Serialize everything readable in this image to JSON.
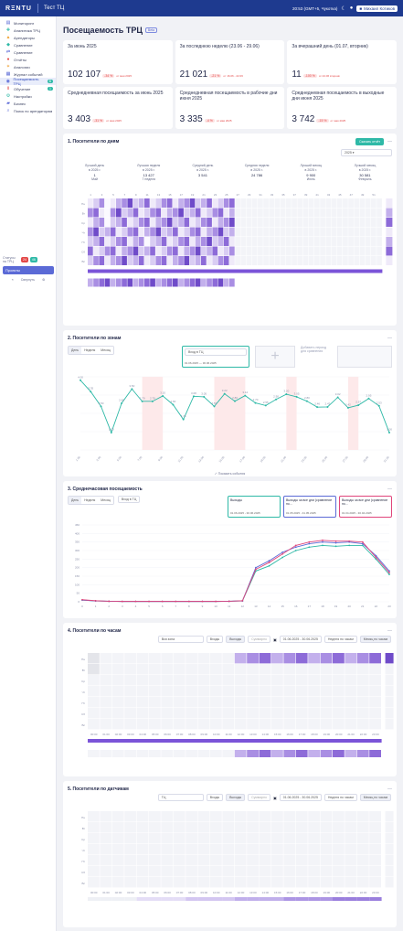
{
  "topbar": {
    "logo": "RΞNTU",
    "project": "Тест ТЦ",
    "datetime": "20:53 (GMT+5, Чукотка)",
    "user": "Михаил Котиков"
  },
  "sidebar": {
    "items": [
      {
        "label": "Мониторинг",
        "icon": "monitor-icon"
      },
      {
        "label": "Аналитика ТРЦ",
        "icon": "analytics-icon"
      },
      {
        "label": "Арендаторы",
        "icon": "tenants-icon"
      },
      {
        "label": "Сравнение",
        "icon": "compare-icon"
      },
      {
        "label": "Сравнение",
        "icon": "compare2-icon"
      },
      {
        "label": "Отчёты",
        "icon": "report-icon"
      },
      {
        "label": "Аналогии",
        "icon": "analogy-icon"
      },
      {
        "label": "Журнал событий",
        "icon": "log-icon"
      },
      {
        "label": "Посещаемость ТРЦ",
        "icon": "visits-icon",
        "active": true,
        "badge": "В"
      },
      {
        "label": "Обучение",
        "icon": "learn-icon",
        "badge": "1"
      },
      {
        "label": "Настройки",
        "icon": "gear-icon"
      },
      {
        "label": "Бизнес",
        "icon": "business-icon"
      },
      {
        "label": "Поиск по арендаторам",
        "icon": "search-icon"
      }
    ],
    "status_label": "Статусы на ТРЦ",
    "status_red": "24",
    "status_green": "46",
    "project_btn": "Проекты",
    "collapse": "Свернуть"
  },
  "page": {
    "title": "Посещаемость ТРЦ",
    "tag": "Beta"
  },
  "cards_row1": [
    {
      "label": "За июнь 2025",
      "value": "102 107",
      "delta": "-34 %",
      "cmp": "от мая 2025"
    },
    {
      "label": "За последнюю неделю (23.06 - 29.06)",
      "value": "21 021",
      "delta": "-21 %",
      "cmp": "от 16.06 - 22.06"
    },
    {
      "label": "За вчерашний день (01.07, вторник)",
      "value": "11",
      "delta": "-100 %",
      "cmp": "от 24.06 вторник"
    }
  ],
  "cards_row2": [
    {
      "label": "Среднедневная посещаемость за июнь 2025",
      "value": "3 403",
      "delta": "-31 %",
      "cmp": "от мая 2025"
    },
    {
      "label": "Среднедневная посещаемость в рабочие дни июня 2025",
      "value": "3 335",
      "delta": "-4 %",
      "cmp": "от мая 2025"
    },
    {
      "label": "Среднедневная посещаемость в выходные дни июня 2025",
      "value": "3 742",
      "delta": "-15 %",
      "cmp": "от мая 2025"
    }
  ],
  "sec1": {
    "title": "1. Посетители по дням",
    "export": "Скачать отчёт",
    "year": "2025",
    "stats": [
      {
        "l1": "Лучший день",
        "l2": "в 2025 г.",
        "v": "1",
        "s": "Май"
      },
      {
        "l1": "Лучшая неделя",
        "l2": "в 2025 г.",
        "v": "13 427",
        "s": "7 неделя"
      },
      {
        "l1": "Средний день",
        "l2": "в 2025 г.",
        "v": "3 541",
        "s": ""
      },
      {
        "l1": "Средняя неделя",
        "l2": "в 2025 г.",
        "v": "24 786",
        "s": ""
      },
      {
        "l1": "Лучший месяц",
        "l2": "в 2025 г.",
        "v": "9 900",
        "s": "Июнь"
      },
      {
        "l1": "Лучший месяц",
        "l2": "в 2025 г.",
        "v": "30 581",
        "s": "Февраль"
      }
    ],
    "weekdays": [
      "Пн",
      "Вт",
      "Ср",
      "Чт",
      "Пт",
      "Сб",
      "Вс"
    ]
  },
  "sec2": {
    "title": "2. Посетители по зонам",
    "tabs": [
      "День",
      "Неделя",
      "Месяц"
    ],
    "zone": "Вход в ТЦ",
    "date_from": "01.06.2025",
    "date_to": "30.06.2025",
    "add": "Добавить период для сравнения",
    "legend": "Показать события"
  },
  "sec3": {
    "title": "3. Среднечасовая посещаемость",
    "tabs": [
      "День",
      "Неделя",
      "Месяц"
    ],
    "zone": "Вход в ТЦ",
    "periods": [
      {
        "label": "Выходы",
        "dates": "01.06.2025 - 30.06.2025",
        "color": "#2fb9a7"
      },
      {
        "label": "Выходы за все дни (сравнение по…",
        "dates": "01.05.2025 - 31.05.2025",
        "color": "#5b6ad6"
      },
      {
        "label": "Выходы за все дни (сравнение по…",
        "dates": "01.04.2025 - 30.04.2025",
        "color": "#e0457b"
      }
    ],
    "yticks": [
      "450",
      "400",
      "350",
      "300",
      "250",
      "200",
      "150",
      "100",
      "50",
      "0"
    ]
  },
  "sec4": {
    "title": "4. Посетители по часам",
    "zone": "Вся зона",
    "entry": "Входы",
    "exit": "Выходы",
    "sum": "Суммарно",
    "range": "01.06.2025 - 30.06.2025",
    "hourly": "Неделя по часам",
    "monthly": "Месяц по часам"
  },
  "sec5": {
    "title": "5. Посетители по датчикам",
    "zone": "ТЦ",
    "entry": "Входы",
    "exit": "Выходы",
    "sum": "Суммарно",
    "range": "01.06.2025 - 30.06.2025",
    "hourly": "Неделя по часам",
    "monthly": "Месяц по часам"
  },
  "chart_data": [
    {
      "type": "line",
      "title": "2. Посетители по зонам",
      "series": [
        {
          "name": "Вход в ТЦ",
          "values": [
            4000,
            3350,
            2500,
            1000,
            2680,
            3500,
            2790,
            2790,
            3100,
            2600,
            1750,
            3080,
            3050,
            2500,
            3220,
            2800,
            3120,
            2700,
            2550,
            2900,
            3200,
            3050,
            2800,
            2460,
            2470,
            3020,
            2420,
            2570,
            2950,
            2530,
            1000
          ]
        }
      ]
    },
    {
      "type": "line",
      "title": "3. Среднечасовая посещаемость",
      "ylim": [
        0,
        450
      ],
      "x": [
        "0",
        "1",
        "2",
        "3",
        "4",
        "5",
        "6",
        "7",
        "8",
        "9",
        "10",
        "11",
        "12",
        "13",
        "14",
        "15",
        "16",
        "17",
        "18",
        "19",
        "20",
        "21",
        "22",
        "23"
      ],
      "series": [
        {
          "name": "Выходы",
          "values": [
            10,
            5,
            3,
            2,
            2,
            2,
            2,
            2,
            2,
            2,
            2,
            3,
            5,
            180,
            210,
            260,
            300,
            320,
            330,
            325,
            330,
            330,
            250,
            160
          ]
        },
        {
          "name": "Выходы за все дни (сравнение по…",
          "values": [
            10,
            5,
            3,
            2,
            2,
            2,
            2,
            2,
            2,
            2,
            2,
            3,
            5,
            200,
            240,
            290,
            320,
            340,
            350,
            345,
            350,
            340,
            270,
            180
          ]
        },
        {
          "name": "Выходы за все дни (сравнение по…",
          "values": [
            12,
            6,
            3,
            2,
            2,
            2,
            2,
            2,
            2,
            2,
            2,
            3,
            6,
            190,
            230,
            280,
            330,
            350,
            360,
            355,
            355,
            350,
            260,
            170
          ]
        }
      ]
    }
  ]
}
